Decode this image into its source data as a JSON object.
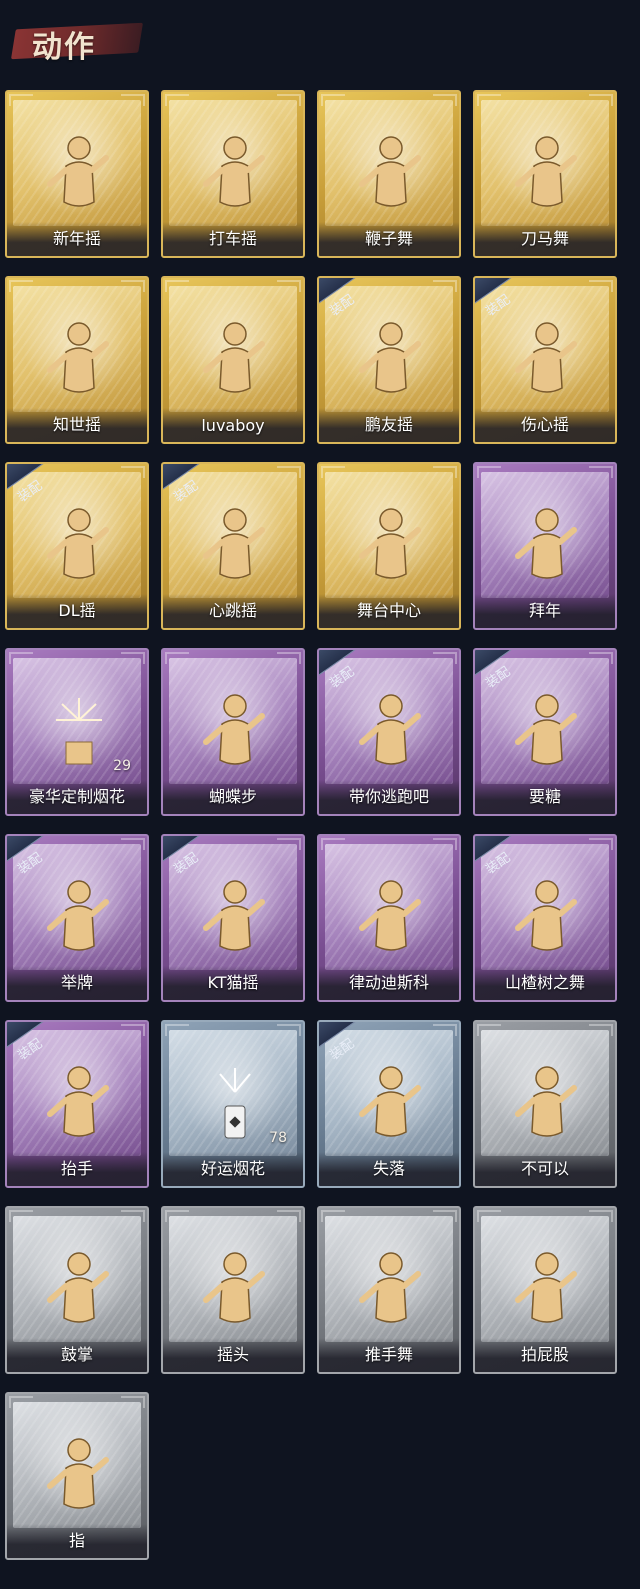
{
  "header": {
    "title": "动作"
  },
  "equip_badge": "装配",
  "cards": [
    {
      "label": "新年摇",
      "tier": "gold",
      "equipped": false,
      "count": "",
      "icon": "dance-pose-icon"
    },
    {
      "label": "打车摇",
      "tier": "gold",
      "equipped": false,
      "count": "",
      "icon": "dance-pose-icon"
    },
    {
      "label": "鞭子舞",
      "tier": "gold",
      "equipped": false,
      "count": "",
      "icon": "dance-pose-icon"
    },
    {
      "label": "刀马舞",
      "tier": "gold",
      "equipped": false,
      "count": "",
      "icon": "dance-pose-icon"
    },
    {
      "label": "知世摇",
      "tier": "gold",
      "equipped": false,
      "count": "",
      "icon": "dance-pose-icon"
    },
    {
      "label": "luvaboy",
      "tier": "gold",
      "equipped": false,
      "count": "",
      "icon": "dance-pose-icon"
    },
    {
      "label": "鹏友摇",
      "tier": "gold",
      "equipped": true,
      "count": "",
      "icon": "dance-pose-icon"
    },
    {
      "label": "伤心摇",
      "tier": "gold",
      "equipped": true,
      "count": "",
      "icon": "heart-hands-icon"
    },
    {
      "label": "DL摇",
      "tier": "gold",
      "equipped": true,
      "count": "",
      "icon": "dance-pose-icon"
    },
    {
      "label": "心跳摇",
      "tier": "gold",
      "equipped": true,
      "count": "",
      "icon": "dance-pose-icon"
    },
    {
      "label": "舞台中心",
      "tier": "gold",
      "equipped": false,
      "count": "",
      "icon": "dance-pose-icon"
    },
    {
      "label": "拜年",
      "tier": "purple",
      "equipped": false,
      "count": "",
      "icon": "bow-greeting-icon"
    },
    {
      "label": "豪华定制烟花",
      "tier": "purple",
      "equipped": false,
      "count": "29",
      "icon": "fireworks-box-icon"
    },
    {
      "label": "蝴蝶步",
      "tier": "purple",
      "equipped": false,
      "count": "",
      "icon": "dance-pose-icon"
    },
    {
      "label": "带你逃跑吧",
      "tier": "purple",
      "equipped": true,
      "count": "",
      "icon": "dance-pose-icon"
    },
    {
      "label": "要糖",
      "tier": "purple",
      "equipped": true,
      "count": "",
      "icon": "reach-hand-icon"
    },
    {
      "label": "举牌",
      "tier": "purple",
      "equipped": true,
      "count": "",
      "icon": "hold-sign-icon"
    },
    {
      "label": "KT猫摇",
      "tier": "purple",
      "equipped": true,
      "count": "",
      "icon": "dance-pose-icon"
    },
    {
      "label": "律动迪斯科",
      "tier": "purple",
      "equipped": false,
      "count": "",
      "icon": "dance-pose-icon"
    },
    {
      "label": "山楂树之舞",
      "tier": "purple",
      "equipped": true,
      "count": "",
      "icon": "dance-pose-icon"
    },
    {
      "label": "抬手",
      "tier": "purple",
      "equipped": true,
      "count": "",
      "icon": "raise-hand-icon"
    },
    {
      "label": "好运烟花",
      "tier": "blue",
      "equipped": false,
      "count": "78",
      "icon": "firework-can-icon"
    },
    {
      "label": "失落",
      "tier": "blue",
      "equipped": true,
      "count": "",
      "icon": "crawl-pose-icon"
    },
    {
      "label": "不可以",
      "tier": "gray",
      "equipped": false,
      "count": "",
      "icon": "finger-wag-icon"
    },
    {
      "label": "鼓掌",
      "tier": "gray",
      "equipped": false,
      "count": "",
      "icon": "clap-icon"
    },
    {
      "label": "摇头",
      "tier": "gray",
      "equipped": false,
      "count": "",
      "icon": "head-shake-icon"
    },
    {
      "label": "推手舞",
      "tier": "gray",
      "equipped": false,
      "count": "",
      "icon": "push-hands-icon"
    },
    {
      "label": "拍屁股",
      "tier": "gray",
      "equipped": false,
      "count": "",
      "icon": "butt-slap-icon"
    },
    {
      "label": "指",
      "tier": "gray",
      "equipped": false,
      "count": "",
      "icon": "point-hand-icon"
    }
  ]
}
